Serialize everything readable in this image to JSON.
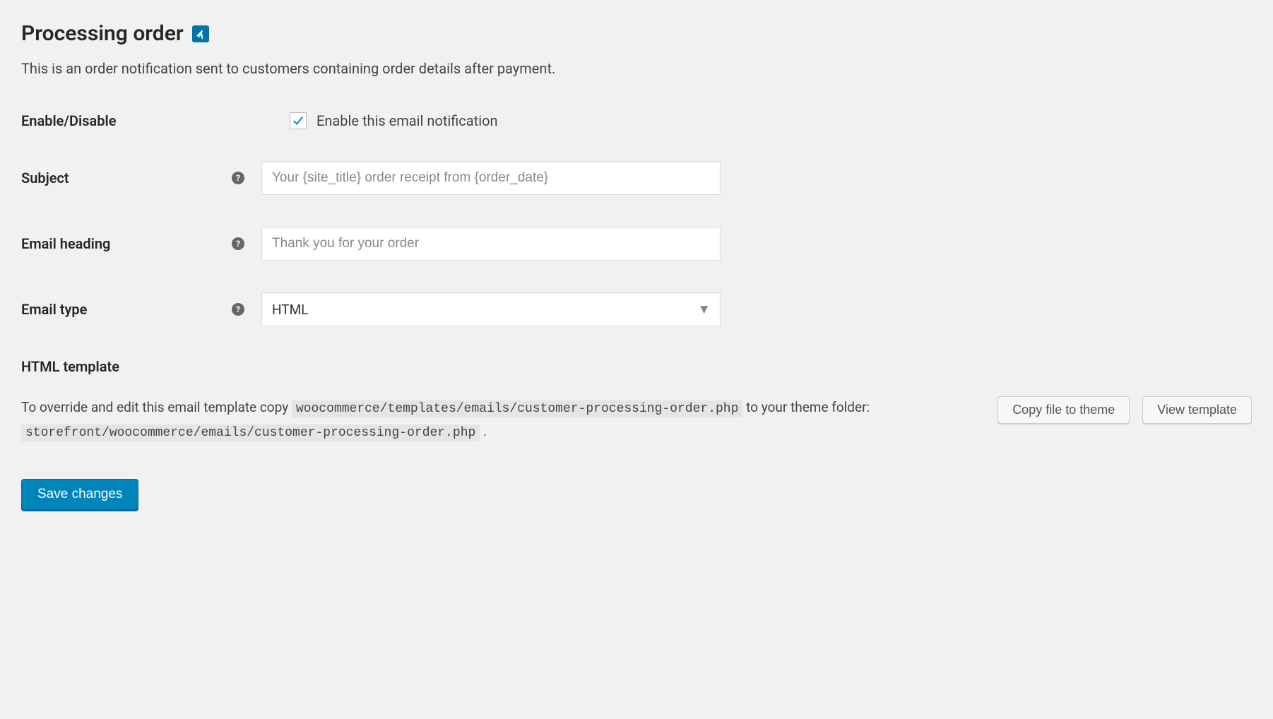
{
  "page": {
    "title": "Processing order",
    "description": "This is an order notification sent to customers containing order details after payment."
  },
  "fields": {
    "enable": {
      "label": "Enable/Disable",
      "checkbox_label": "Enable this email notification",
      "checked": true
    },
    "subject": {
      "label": "Subject",
      "placeholder": "Your {site_title} order receipt from {order_date}",
      "value": ""
    },
    "heading": {
      "label": "Email heading",
      "placeholder": "Thank you for your order",
      "value": ""
    },
    "type": {
      "label": "Email type",
      "selected": "HTML"
    }
  },
  "template": {
    "heading": "HTML template",
    "text_before": "To override and edit this email template copy ",
    "path_source": "woocommerce/templates/emails/customer-processing-order.php",
    "text_middle": " to your theme folder: ",
    "path_dest": "storefront/woocommerce/emails/customer-processing-order.php",
    "text_after": " .",
    "copy_button": "Copy file to theme",
    "view_button": "View template"
  },
  "actions": {
    "save": "Save changes"
  }
}
